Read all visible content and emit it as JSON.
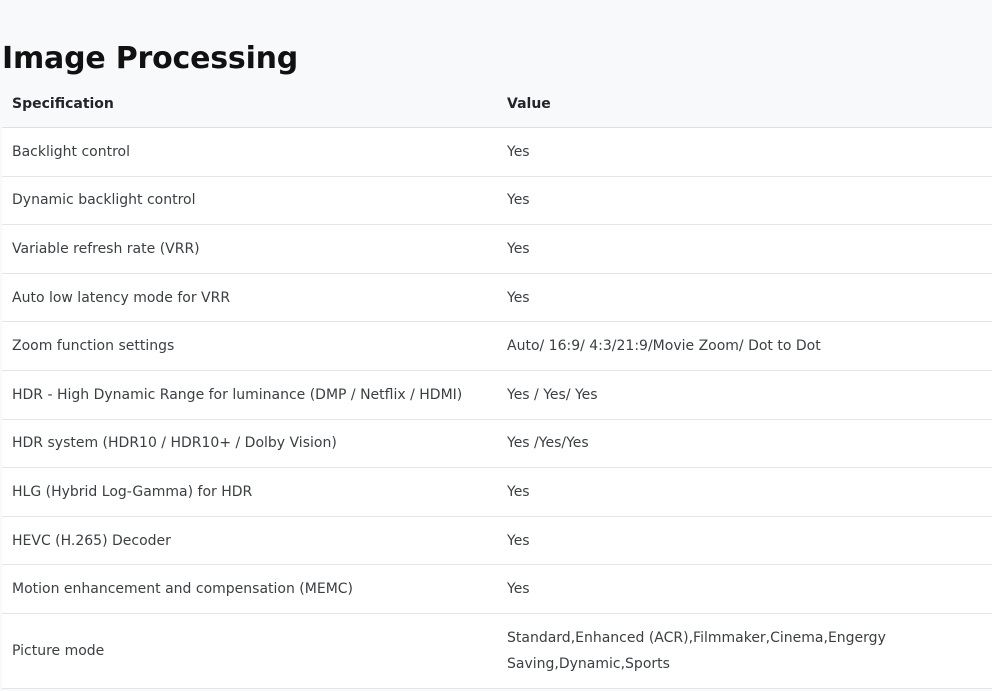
{
  "title": "Image Processing",
  "table": {
    "headers": [
      "Specification",
      "Value"
    ],
    "rows": [
      {
        "spec": "Backlight control",
        "value": "Yes"
      },
      {
        "spec": "Dynamic backlight control",
        "value": "Yes"
      },
      {
        "spec": "Variable refresh rate (VRR)",
        "value": "Yes"
      },
      {
        "spec": "Auto low latency mode for VRR",
        "value": "Yes"
      },
      {
        "spec": "Zoom function settings",
        "value": "Auto/ 16:9/ 4:3/21:9/Movie Zoom/ Dot to Dot"
      },
      {
        "spec": "HDR - High Dynamic Range for luminance (DMP / Netflix / HDMI)",
        "value": "Yes / Yes/ Yes"
      },
      {
        "spec": "HDR system (HDR10 / HDR10+ / Dolby Vision)",
        "value": "Yes /Yes/Yes"
      },
      {
        "spec": "HLG (Hybrid Log-Gamma) for HDR",
        "value": "Yes"
      },
      {
        "spec": "HEVC (H.265) Decoder",
        "value": "Yes"
      },
      {
        "spec": "Motion enhancement and compensation (MEMC)",
        "value": "Yes"
      },
      {
        "spec": "Picture mode",
        "value": "Standard,Enhanced (ACR),Filmmaker,Cinema,Engergy Saving,Dynamic,Sports"
      }
    ]
  }
}
